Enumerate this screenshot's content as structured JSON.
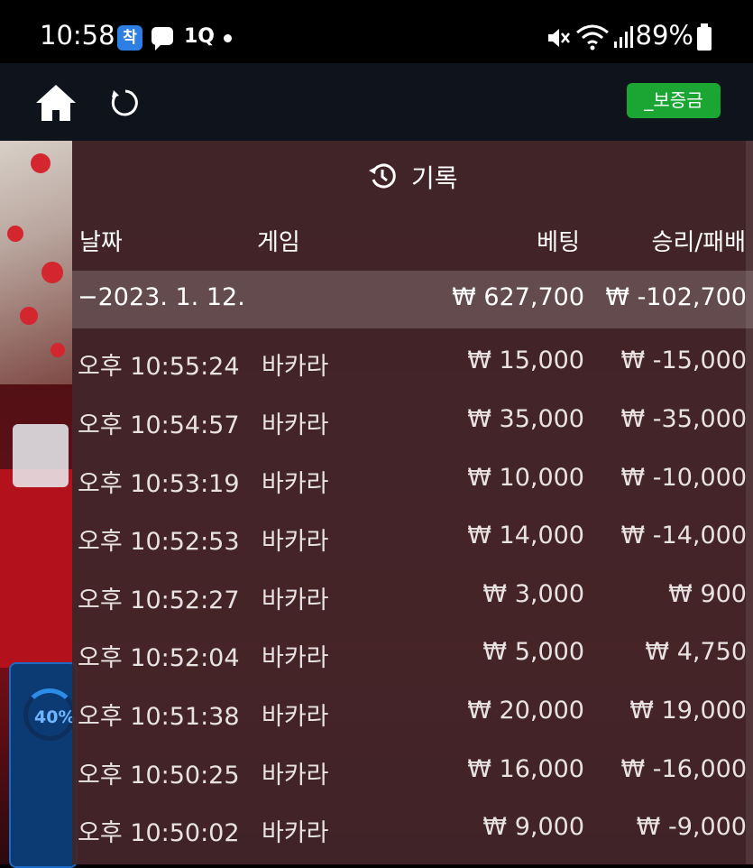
{
  "status_bar": {
    "time": "10:58",
    "app_icon_1": "착",
    "app_icon_3": "1Q",
    "battery": "89%"
  },
  "nav": {
    "deposit_label": "_보증금"
  },
  "background": {
    "progress_label": "40%"
  },
  "history": {
    "title": "기록",
    "columns": {
      "date": "날짜",
      "game": "게임",
      "bet": "베팅",
      "winloss": "승리/패배"
    },
    "date_group": {
      "label": "−2023. 1. 12.",
      "bet_total": "₩ 627,700",
      "winloss_total": "₩ -102,700"
    },
    "rows": [
      {
        "time": "오후 10:55:24",
        "game": "바카라",
        "bet": "₩ 15,000",
        "winloss": "₩ -15,000"
      },
      {
        "time": "오후 10:54:57",
        "game": "바카라",
        "bet": "₩ 35,000",
        "winloss": "₩ -35,000"
      },
      {
        "time": "오후 10:53:19",
        "game": "바카라",
        "bet": "₩ 10,000",
        "winloss": "₩ -10,000"
      },
      {
        "time": "오후 10:52:53",
        "game": "바카라",
        "bet": "₩ 14,000",
        "winloss": "₩ -14,000"
      },
      {
        "time": "오후 10:52:27",
        "game": "바카라",
        "bet": "₩ 3,000",
        "winloss": "₩ 900"
      },
      {
        "time": "오후 10:52:04",
        "game": "바카라",
        "bet": "₩ 5,000",
        "winloss": "₩ 4,750"
      },
      {
        "time": "오후 10:51:38",
        "game": "바카라",
        "bet": "₩ 20,000",
        "winloss": "₩ 19,000"
      },
      {
        "time": "오후 10:50:25",
        "game": "바카라",
        "bet": "₩ 16,000",
        "winloss": "₩ -16,000"
      },
      {
        "time": "오후 10:50:02",
        "game": "바카라",
        "bet": "₩ 9,000",
        "winloss": "₩ -9,000"
      }
    ]
  },
  "colors": {
    "deposit_button": "#1ba634",
    "panel": "#42262a",
    "nav_bar": "#0f141c"
  }
}
